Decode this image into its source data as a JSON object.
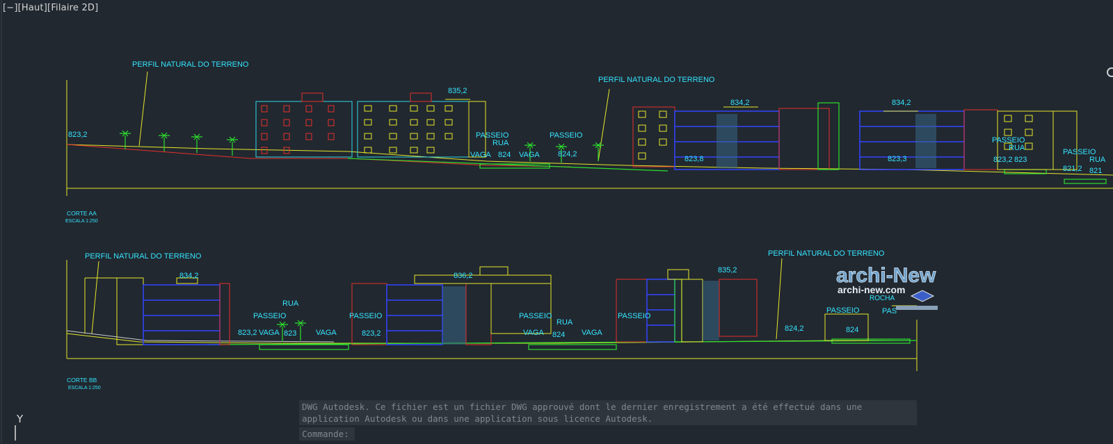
{
  "viewport": {
    "label": "[−][Haut][Filaire 2D]"
  },
  "section_aa": {
    "title": "CORTE AA",
    "scale": "ESCALA  1:250",
    "labels": {
      "perfil_1": "PERFIL NATURAL DO TERRENO",
      "perfil_2": "PERFIL NATURAL DO TERRENO",
      "lvl_8232": "823,2",
      "lvl_8352": "835,2",
      "passeio_1": "PASSEIO",
      "rua_1": "RUA",
      "vaga_1": "VAGA",
      "lvl_824": "824",
      "vaga_2": "VAGA",
      "passeio_2": "PASSEIO",
      "lvl_8242": "824,2",
      "lvl_8342a": "834,2",
      "lvl_8238": "823,8",
      "lvl_8342b": "834,2",
      "lvl_8233": "823,3",
      "passeio_3": "PASSEIO",
      "rua_2": "RUA",
      "lvl_8232b": "823,2",
      "lvl_823": "823",
      "passeio_4": "PASSEIO",
      "rua_3": "RUA",
      "lvl_8212": "821,2",
      "lvl_821": "821"
    }
  },
  "section_bb": {
    "title": "CORTE BB",
    "scale": "ESCALA  1:250",
    "labels": {
      "perfil_1": "PERFIL NATURAL DO TERRENO",
      "perfil_2": "PERFIL NATURAL DO TERRENO",
      "lvl_8342": "834,2",
      "passeio_1": "PASSEIO",
      "rua_1": "RUA",
      "lvl_8232": "823,2",
      "vaga_1": "VAGA",
      "lvl_823": "823",
      "vaga_2": "VAGA",
      "passeio_2": "PASSEIO",
      "lvl_8232b": "823,2",
      "lvl_8362": "836,2",
      "passeio_3": "PASSEIO",
      "rua_2": "RUA",
      "vaga_3": "VAGA",
      "lvl_824": "824",
      "vaga_4": "VAGA",
      "passeio_4": "PASSEIO",
      "lvl_8352": "835,2",
      "lvl_8242": "824,2",
      "passeio_5": "PASSEIO",
      "lvl_824b": "824",
      "rocha": "ROCHA",
      "pas": "PAS"
    }
  },
  "watermark": {
    "brand": "archi-New",
    "url": "archi-new.com"
  },
  "ucs": {
    "axis_label": "Y"
  },
  "command_line": {
    "history_line1": "DWG Autodesk.  Ce fichier est un fichier DWG approuvé dont le dernier enregistrement a été effectué dans une",
    "history_line2": "application Autodesk ou dans une application sous licence Autodesk.",
    "prompt": "Commande:"
  },
  "colors": {
    "background": "#212830",
    "text_cyan": "#36e5ff",
    "line_yellow": "#e8e82a",
    "line_red": "#e8302a",
    "line_green": "#2ee02e",
    "line_blue": "#3244ff"
  }
}
